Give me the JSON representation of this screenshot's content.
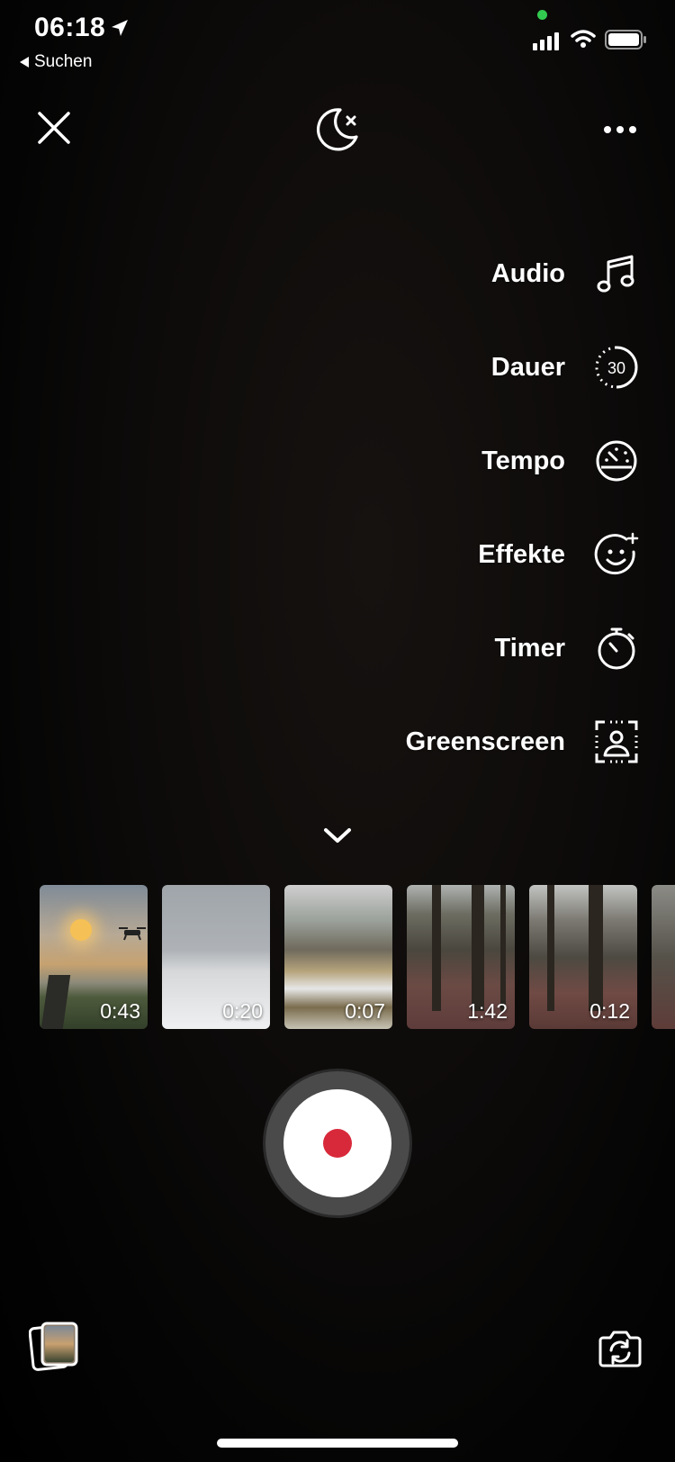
{
  "status_bar": {
    "time": "06:18",
    "back_app": "Suchen"
  },
  "top_bar": {
    "close_icon": "close-icon",
    "night_mode_icon": "moon-x-icon",
    "more_icon": "more-horizontal-icon"
  },
  "menu": {
    "items": [
      {
        "label": "Audio",
        "icon": "music-note-icon"
      },
      {
        "label": "Dauer",
        "icon": "duration-30-icon",
        "icon_text": "30"
      },
      {
        "label": "Tempo",
        "icon": "speedometer-icon"
      },
      {
        "label": "Effekte",
        "icon": "face-sparkle-icon"
      },
      {
        "label": "Timer",
        "icon": "stopwatch-icon"
      },
      {
        "label": "Greenscreen",
        "icon": "greenscreen-icon"
      }
    ]
  },
  "thumbnails": [
    {
      "duration": "0:43"
    },
    {
      "duration": "0:20"
    },
    {
      "duration": "0:07"
    },
    {
      "duration": "1:42"
    },
    {
      "duration": "0:12"
    },
    {
      "duration": ""
    }
  ],
  "colors": {
    "record_dot": "#d8293a",
    "status_dot": "#32c950"
  }
}
